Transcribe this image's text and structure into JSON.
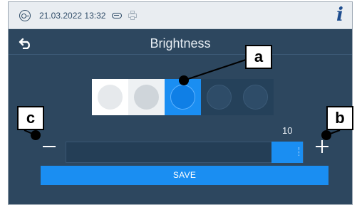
{
  "statusbar": {
    "datetime": "21.03.2022 13:32",
    "info_label": "i"
  },
  "screen": {
    "title": "Brightness"
  },
  "brightness": {
    "value_label": "10",
    "level_fraction": 1.0,
    "selected_swatch": 3,
    "swatch_count": 5
  },
  "buttons": {
    "save_label": "SAVE"
  },
  "callouts": {
    "a": "a",
    "b": "b",
    "c": "c"
  },
  "colors": {
    "accent": "#1a8ef2",
    "background": "#2d475f",
    "statusbar": "#e9edf1",
    "info_icon": "#1e4d8e"
  }
}
